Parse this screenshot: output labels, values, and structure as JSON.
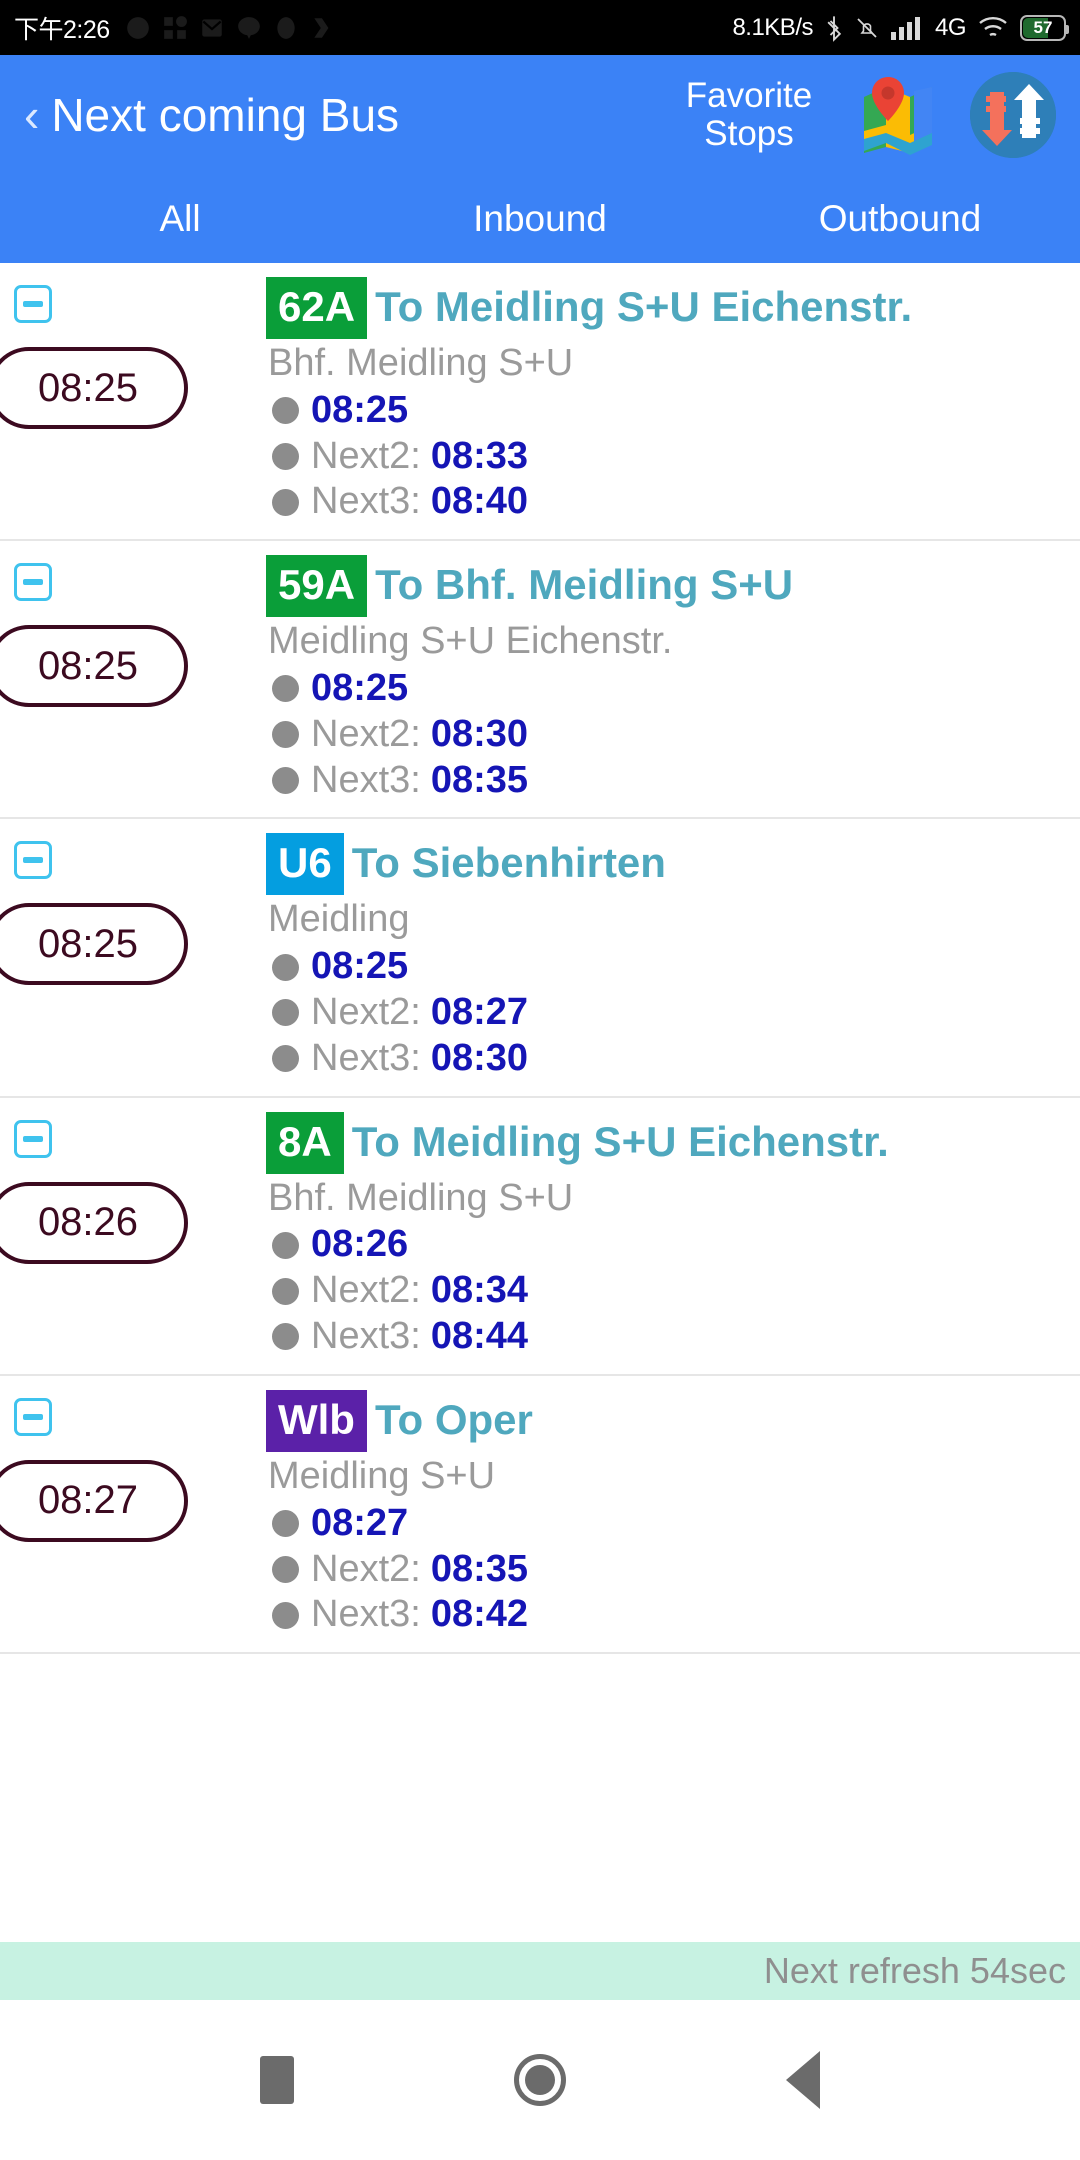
{
  "status_bar": {
    "clock": "下午2:26",
    "network_speed": "8.1KB/s",
    "mobile_network": "4G",
    "battery_percent": "57",
    "icons": [
      "chrome-icon",
      "apps-icon",
      "gmail-icon",
      "line-icon",
      "circle-app-icon",
      "check-app-icon",
      "bluetooth-icon",
      "silent-mode-icon",
      "signal-bars-icon",
      "wifi-icon",
      "battery-icon"
    ]
  },
  "appbar": {
    "back_label": "‹",
    "title": "Next coming Bus",
    "favorite_stops_label": "Favorite\nStops",
    "favorite_stops_line1": "Favorite",
    "favorite_stops_line2": "Stops",
    "map_icon": "map-icon",
    "sync_icon": "sync-updown-icon",
    "background_color": "#3b82f6"
  },
  "tabs": {
    "items": [
      {
        "label": "All",
        "active": true
      },
      {
        "label": "Inbound",
        "active": false
      },
      {
        "label": "Outbound",
        "active": false
      }
    ],
    "indicator_color": "#35c6dd"
  },
  "departures": [
    {
      "route": "62A",
      "route_color": "#0a9e39",
      "destination": "To Meidling S+U Eichenstr.",
      "stop": "Bhf. Meidling S+U",
      "pill_time": "08:25",
      "times": [
        {
          "label": "",
          "value": "08:25"
        },
        {
          "label": "Next2:",
          "value": "08:33"
        },
        {
          "label": "Next3:",
          "value": "08:40"
        }
      ]
    },
    {
      "route": "59A",
      "route_color": "#0a9e39",
      "destination": "To Bhf. Meidling S+U",
      "stop": "Meidling S+U Eichenstr.",
      "pill_time": "08:25",
      "times": [
        {
          "label": "",
          "value": "08:25"
        },
        {
          "label": "Next2:",
          "value": "08:30"
        },
        {
          "label": "Next3:",
          "value": "08:35"
        }
      ]
    },
    {
      "route": "U6",
      "route_color": "#049ee0",
      "destination": "To Siebenhirten",
      "stop": "Meidling",
      "pill_time": "08:25",
      "times": [
        {
          "label": "",
          "value": "08:25"
        },
        {
          "label": "Next2:",
          "value": "08:27"
        },
        {
          "label": "Next3:",
          "value": "08:30"
        }
      ]
    },
    {
      "route": "8A",
      "route_color": "#0a9e39",
      "destination": "To Meidling S+U Eichenstr.",
      "stop": "Bhf. Meidling S+U",
      "pill_time": "08:26",
      "times": [
        {
          "label": "",
          "value": "08:26"
        },
        {
          "label": "Next2:",
          "value": "08:34"
        },
        {
          "label": "Next3:",
          "value": "08:44"
        }
      ]
    },
    {
      "route": "Wlb",
      "route_color": "#5b21a8",
      "destination": "To Oper",
      "stop": "Meidling S+U",
      "pill_time": "08:27",
      "times": [
        {
          "label": "",
          "value": "08:27"
        },
        {
          "label": "Next2:",
          "value": "08:35"
        },
        {
          "label": "Next3:",
          "value": "08:42"
        }
      ]
    }
  ],
  "footer": {
    "refresh_text": "Next refresh 54sec",
    "background_color": "#c7f2e2"
  },
  "navbar": {
    "recents_icon": "square-recents-icon",
    "home_icon": "circle-home-icon",
    "back_icon": "triangle-back-icon"
  }
}
